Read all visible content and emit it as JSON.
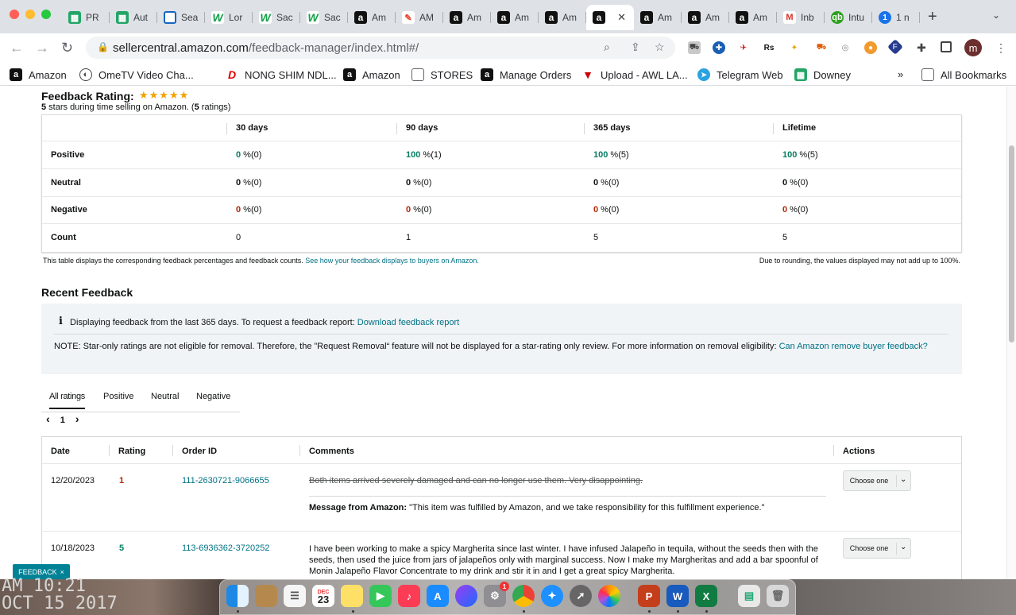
{
  "browser": {
    "tabs": [
      {
        "title": "PR",
        "icon": "sheets-icon"
      },
      {
        "title": "Aut",
        "icon": "sheets-icon"
      },
      {
        "title": "Sea",
        "icon": "diamond-icon"
      },
      {
        "title": "Lor",
        "icon": "w-icon"
      },
      {
        "title": "Sac",
        "icon": "w-icon"
      },
      {
        "title": "Sac",
        "icon": "w-icon"
      },
      {
        "title": "Am",
        "icon": "amazon-icon"
      },
      {
        "title": "AM",
        "icon": "pencil-icon"
      },
      {
        "title": "Am",
        "icon": "amazon-icon"
      },
      {
        "title": "Am",
        "icon": "amazon-icon"
      },
      {
        "title": "Am",
        "icon": "amazon-icon"
      },
      {
        "title": "",
        "icon": "amazon-icon",
        "active": true
      },
      {
        "title": "Am",
        "icon": "amazon-icon"
      },
      {
        "title": "Am",
        "icon": "amazon-icon"
      },
      {
        "title": "Am",
        "icon": "amazon-icon"
      },
      {
        "title": "Inb",
        "icon": "gmail-icon"
      },
      {
        "title": "Intu",
        "icon": "qb-icon"
      },
      {
        "title": "1 n",
        "icon": "onepassword-icon"
      }
    ],
    "url_host": "sellercentral.amazon.com",
    "url_path": "/feedback-manager/index.html#/",
    "avatar_letter": "m",
    "bookmarks": [
      {
        "label": "Amazon"
      },
      {
        "label": "OmeTV Video Cha..."
      },
      {
        "label": "NONG SHIM NDL..."
      },
      {
        "label": "Amazon"
      },
      {
        "label": "STORES"
      },
      {
        "label": "Manage Orders"
      },
      {
        "label": "Upload - AWL LA..."
      },
      {
        "label": "Telegram Web"
      },
      {
        "label": "Downey"
      }
    ],
    "all_bookmarks": "All Bookmarks",
    "overflow": "»"
  },
  "rating": {
    "title": "Feedback Rating:",
    "stars": "★★★★★",
    "stars_count": "5",
    "sub_mid": " stars during time selling on Amazon. (",
    "ratings_count": "5",
    "sub_end": " ratings)",
    "columns": [
      "30 days",
      "90 days",
      "365 days",
      "Lifetime"
    ],
    "rows": [
      {
        "label": "Positive",
        "cells": [
          [
            "0",
            " %(0)"
          ],
          [
            "100",
            " %(1)"
          ],
          [
            "100",
            " %(5)"
          ],
          [
            "100",
            " %(5)"
          ]
        ],
        "color": "green"
      },
      {
        "label": "Neutral",
        "cells": [
          [
            "0",
            " %(0)"
          ],
          [
            "0",
            " %(0)"
          ],
          [
            "0",
            " %(0)"
          ],
          [
            "0",
            " %(0)"
          ]
        ],
        "color": "black"
      },
      {
        "label": "Negative",
        "cells": [
          [
            "0",
            " %(0)"
          ],
          [
            "0",
            " %(0)"
          ],
          [
            "0",
            " %(0)"
          ],
          [
            "0",
            " %(0)"
          ]
        ],
        "color": "red"
      },
      {
        "label": "Count",
        "cells": [
          [
            "",
            "0"
          ],
          [
            "",
            "1"
          ],
          [
            "",
            "5"
          ],
          [
            "",
            "5"
          ]
        ],
        "color": "none"
      }
    ],
    "footnote_left": "This table displays the corresponding feedback percentages and feedback counts. ",
    "footnote_link": "See how your feedback displays to buyers on Amazon.",
    "footnote_right": "Due to rounding, the values displayed may not add up to 100%."
  },
  "recent": {
    "title": "Recent Feedback",
    "info_text": "Displaying feedback from the last 365 days. To request a feedback report: ",
    "info_link": "Download feedback report",
    "note_text": "NOTE: Star-only ratings are not eligible for removal. Therefore, the ”Request Removal“ feature will not be displayed for a star-rating only review. For more information on removal eligibility: ",
    "note_link": "Can Amazon remove buyer feedback?",
    "filters": [
      "All ratings",
      "Positive",
      "Neutral",
      "Negative"
    ],
    "page": "1",
    "prev": "‹",
    "next": "›",
    "headers": [
      "Date",
      "Rating",
      "Order ID",
      "Comments",
      "Actions"
    ],
    "rows": [
      {
        "date": "12/20/2023",
        "rating": "1",
        "order_id": "111-2630721-9066655",
        "comment": "Both items arrived severely damaged and can no longer use them. Very disappointing.",
        "message_label": "Message from Amazon:",
        "message": " \"This item was fulfilled by Amazon, and we take responsibility for this fulfillment experience.\"",
        "action": "Choose one"
      },
      {
        "date": "10/18/2023",
        "rating": "5",
        "order_id": "113-6936362-3720252",
        "comment": "I have been working to make a spicy Margherita since last winter. I have infused Jalapeño in tequila, without the seeds then with the seeds, then used the juice from jars of jalapeños only with marginal success. Now I make my Margheritas and add a bar spoonful of Monin Jalapeño Flavor Concentrate to my drink and stir it in and I get a great spicy Margherita.",
        "action": "Choose one"
      }
    ]
  },
  "feedback_button": {
    "label": "FEEDBACK",
    "close": "×"
  },
  "desktop": {
    "clock_line1": "AM 10:21",
    "clock_line2": "OCT 15 2017"
  },
  "dock": {
    "calendar_month": "DEC",
    "calendar_day": "23",
    "badge": "1"
  }
}
